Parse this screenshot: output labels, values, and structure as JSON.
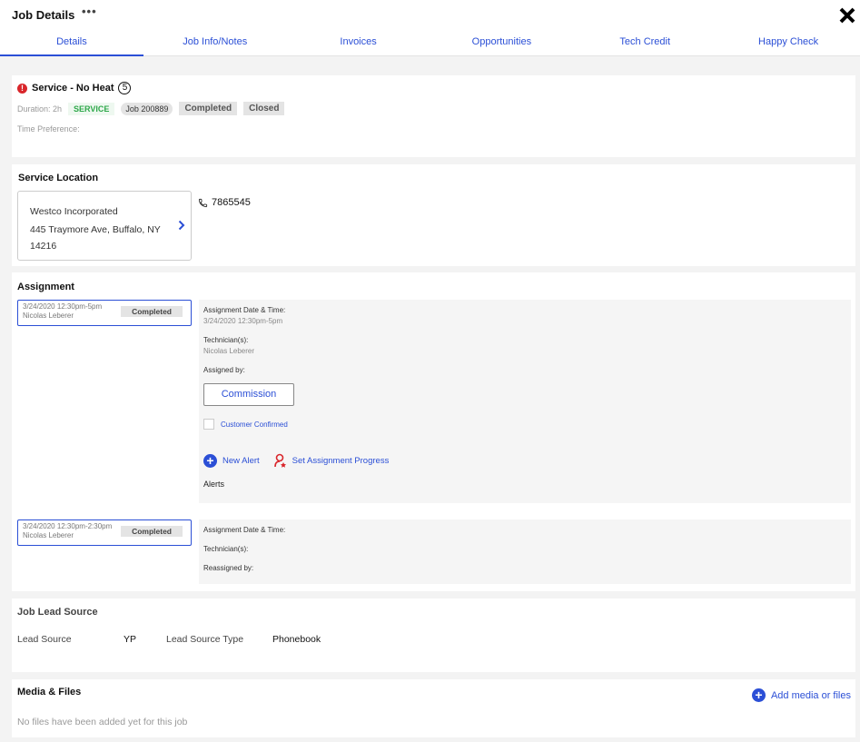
{
  "header": {
    "title": "Job Details",
    "more_label": "•••",
    "close_icon": "close-icon"
  },
  "tabs": [
    {
      "label": "Details",
      "active": true
    },
    {
      "label": "Job Info/Notes",
      "active": false
    },
    {
      "label": "Invoices",
      "active": false
    },
    {
      "label": "Opportunities",
      "active": false
    },
    {
      "label": "Tech Credit",
      "active": false
    },
    {
      "label": "Happy Check",
      "active": false
    }
  ],
  "service": {
    "title": "Service - No Heat",
    "count": "5",
    "duration": "Duration: 2h",
    "type_badge": "SERVICE",
    "job_badge": "Job 200889",
    "status_badge": "Completed",
    "state_badge": "Closed",
    "time_preference": "Time Preference:"
  },
  "location": {
    "section_title": "Service Location",
    "name": "Westco Incorporated",
    "address_line1": "445 Traymore Ave, Buffalo, NY",
    "address_line2": "14216",
    "phone": "7865545"
  },
  "assignment": {
    "section_title": "Assignment",
    "items": [
      {
        "time": "3/24/2020 12:30pm-5pm",
        "tech": "Nicolas Leberer",
        "status": "Completed",
        "date_label": "Assignment Date & Time:",
        "date_value": "3/24/2020 12:30pm-5pm",
        "tech_label": "Technician(s):",
        "tech_value": "Nicolas Leberer",
        "assigned_label": "Assigned by:",
        "commission_label": "Commission",
        "confirmed_label": "Customer Confirmed",
        "new_alert_label": "New Alert",
        "progress_label": "Set Assignment Progress",
        "alerts_label": "Alerts"
      },
      {
        "time": "3/24/2020 12:30pm-2:30pm",
        "tech": "Nicolas Leberer",
        "status": "Completed",
        "date_label": "Assignment Date & Time:",
        "tech_label": "Technician(s):",
        "reassigned_label": "Reassigned by:"
      }
    ]
  },
  "lead": {
    "section_title": "Job Lead Source",
    "source_label": "Lead Source",
    "source_value": "YP",
    "type_label": "Lead Source Type",
    "type_value": "Phonebook"
  },
  "media": {
    "section_title": "Media & Files",
    "add_label": "Add media or files",
    "empty_text": "No files have been added yet for this job"
  },
  "colors": {
    "accent": "#2b4fd6",
    "error": "#d9262b",
    "success": "#2ea84a",
    "progress_icon": "#d9262b"
  }
}
